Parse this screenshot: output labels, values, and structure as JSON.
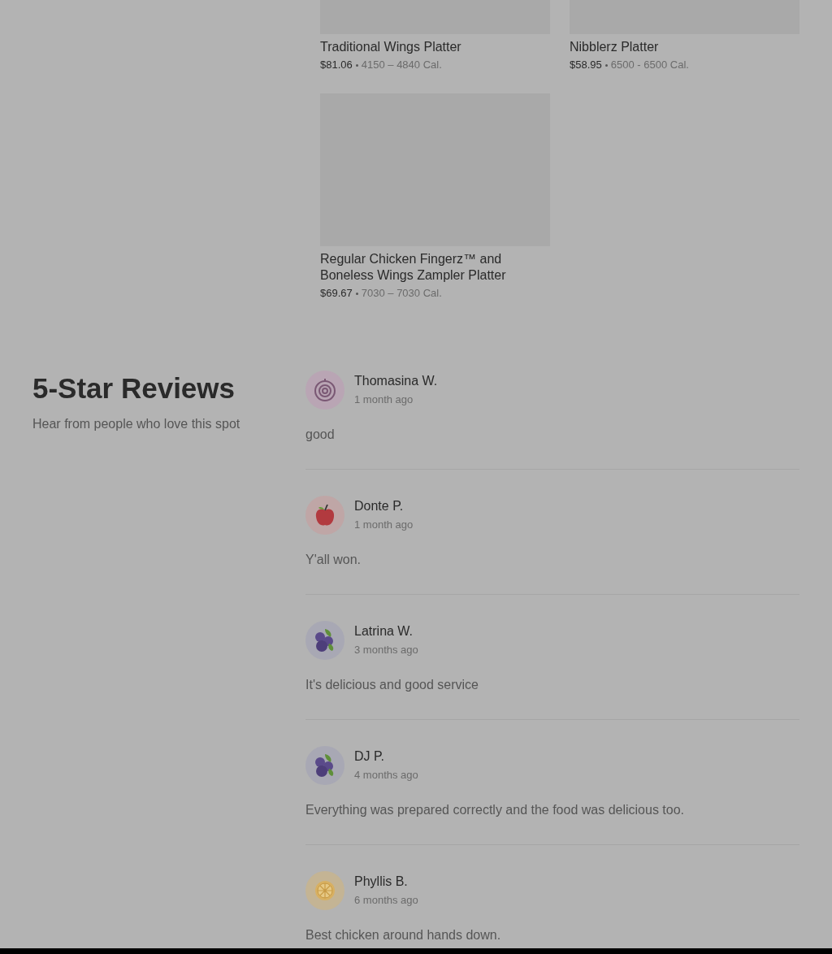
{
  "menu_items": [
    {
      "name": "Traditional Wings Platter",
      "price": "$81.06",
      "calories": "4150 – 4840 Cal."
    },
    {
      "name": "Nibblerz Platter",
      "price": "$58.95",
      "calories": "6500 - 6500 Cal."
    },
    {
      "name": "Regular Chicken Fingerz™ and Boneless Wings Zampler Platter",
      "price": "$69.67",
      "calories": "7030 – 7030 Cal."
    }
  ],
  "reviews_section": {
    "title": "5-Star Reviews",
    "subtitle": "Hear from people who love this spot"
  },
  "reviews": [
    {
      "name": "Thomasina W.",
      "time": "1 month ago",
      "text": "good"
    },
    {
      "name": "Donte P.",
      "time": "1 month ago",
      "text": "Y'all won."
    },
    {
      "name": "Latrina W.",
      "time": "3 months ago",
      "text": "It's delicious and good service"
    },
    {
      "name": "DJ P.",
      "time": "4 months ago",
      "text": "Everything was prepared correctly and the food was delicious too."
    },
    {
      "name": "Phyllis B.",
      "time": "6 months ago",
      "text": "Best chicken around hands down."
    }
  ]
}
